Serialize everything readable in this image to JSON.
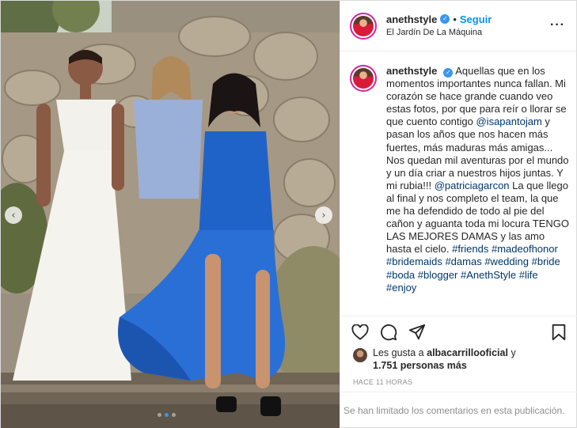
{
  "post": {
    "username": "anethstyle",
    "follow_label": "Seguir",
    "separator": "•",
    "location": "El Jardín De La Máquina",
    "more_label": "···",
    "caption": {
      "username": "anethstyle",
      "segments": [
        {
          "type": "text",
          "value": "Aquellas que en los momentos importantes nunca fallan. Mi corazón se hace grande cuando veo estas fotos, por que para reír o llorar se que cuento contigo "
        },
        {
          "type": "link",
          "value": "@isapantojam"
        },
        {
          "type": "text",
          "value": " y pasan los años que nos hacen más fuertes, más maduras más amigas... Nos quedan mil aventuras por el mundo y un día criar a nuestros hijos juntas. Y mi rubia!!! "
        },
        {
          "type": "link",
          "value": "@patriciagarcon"
        },
        {
          "type": "text",
          "value": " La que llego al final y nos completo el team, la que me ha defendido de todo al pie del cañon y aguanta toda mi locura TENGO LAS MEJORES DAMAS y las amo hasta el cielo. "
        },
        {
          "type": "link",
          "value": "#friends"
        },
        {
          "type": "text",
          "value": " "
        },
        {
          "type": "link",
          "value": "#madeofhonor"
        },
        {
          "type": "text",
          "value": " "
        },
        {
          "type": "link",
          "value": "#bridemaids"
        },
        {
          "type": "text",
          "value": " "
        },
        {
          "type": "link",
          "value": "#damas"
        },
        {
          "type": "text",
          "value": " "
        },
        {
          "type": "link",
          "value": "#wedding"
        },
        {
          "type": "text",
          "value": " "
        },
        {
          "type": "link",
          "value": "#bride"
        },
        {
          "type": "text",
          "value": " "
        },
        {
          "type": "link",
          "value": "#boda"
        },
        {
          "type": "text",
          "value": " "
        },
        {
          "type": "link",
          "value": "#blogger"
        },
        {
          "type": "text",
          "value": " "
        },
        {
          "type": "link",
          "value": "#AnethStyle"
        },
        {
          "type": "text",
          "value": " "
        },
        {
          "type": "link",
          "value": "#life"
        },
        {
          "type": "text",
          "value": " "
        },
        {
          "type": "link",
          "value": "#enjoy"
        }
      ]
    },
    "actions": {
      "like_icon": "heart-icon",
      "comment_icon": "comment-icon",
      "share_icon": "share-icon",
      "save_icon": "bookmark-icon"
    },
    "likes": {
      "prefix": "Les gusta a",
      "user": "albacarrillooficial",
      "connector": "y",
      "count": "1.751 personas más"
    },
    "time": "HACE 11 HORAS",
    "comments_limited": "Se han limitado los comentarios en esta publicación.",
    "carousel": {
      "prev_icon": "chevron-left-icon",
      "next_icon": "chevron-right-icon",
      "prev_glyph": "‹",
      "next_glyph": "›",
      "dots": 3,
      "active_dot": 1
    },
    "colors": {
      "accent": "#0095f6",
      "verified": "#3897f0",
      "link": "#00376b",
      "muted": "#8e8e8e"
    }
  }
}
